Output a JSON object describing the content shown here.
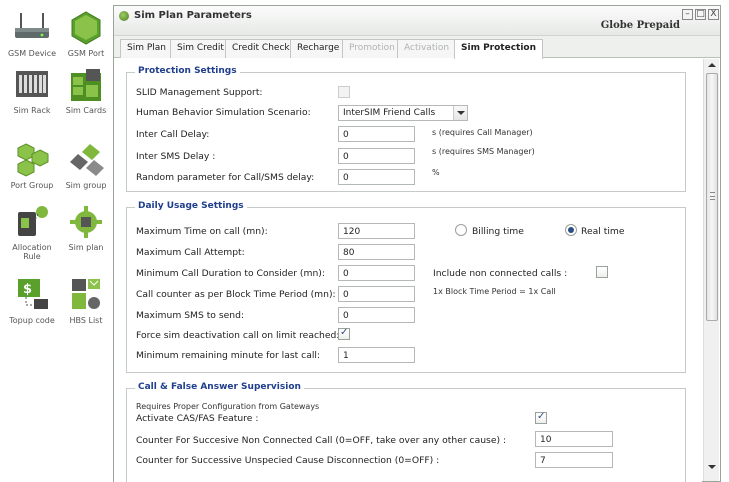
{
  "launcher": {
    "items": [
      {
        "label": "GSM Device",
        "icon": "gsm-device-icon"
      },
      {
        "label": "GSM Port",
        "icon": "gsm-port-icon"
      },
      {
        "label": "Sim Rack",
        "icon": "sim-rack-icon"
      },
      {
        "label": "Sim Cards",
        "icon": "sim-cards-icon"
      },
      {
        "label": "Port Group",
        "icon": "port-group-icon"
      },
      {
        "label": "Sim group",
        "icon": "sim-group-icon"
      },
      {
        "label": "Allocation Rule",
        "icon": "allocation-rule-icon"
      },
      {
        "label": "Sim plan",
        "icon": "sim-plan-icon"
      },
      {
        "label": "Topup code",
        "icon": "topup-code-icon"
      },
      {
        "label": "HBS List",
        "icon": "hbs-list-icon"
      }
    ]
  },
  "window": {
    "title": "Sim Plan Parameters",
    "subtitle": "Globe Prepaid",
    "buttons": {
      "minimize": "–",
      "maximize": "□",
      "close": "X"
    }
  },
  "tabs": [
    {
      "label": "Sim Plan",
      "state": "normal"
    },
    {
      "label": "Sim Credit",
      "state": "normal"
    },
    {
      "label": "Credit Check",
      "state": "normal"
    },
    {
      "label": "Recharge",
      "state": "normal"
    },
    {
      "label": "Promotion",
      "state": "disabled"
    },
    {
      "label": "Activation",
      "state": "disabled"
    },
    {
      "label": "Sim Protection",
      "state": "active"
    }
  ],
  "protection": {
    "legend": "Protection Settings",
    "slid_label": "SLID Management Support:",
    "hbs_label": "Human Behavior Simulation Scenario:",
    "hbs_value": "InterSIM Friend Calls",
    "call_delay_label": "Inter Call Delay:",
    "call_delay_value": "0",
    "call_delay_note": "s (requires Call Manager)",
    "sms_delay_label": "Inter SMS Delay :",
    "sms_delay_value": "0",
    "sms_delay_note": "s (requires SMS Manager)",
    "random_label": "Random parameter for Call/SMS delay:",
    "random_value": "0",
    "random_note": "%"
  },
  "daily": {
    "legend": "Daily Usage Settings",
    "max_time_label": "Maximum Time on call (mn):",
    "max_time_value": "120",
    "billing_label": "Billing time",
    "real_label": "Real time",
    "max_attempt_label": "Maximum Call Attempt:",
    "max_attempt_value": "80",
    "min_duration_label": "Minimum Call Duration to Consider (mn):",
    "min_duration_value": "0",
    "include_label": "Include non connected calls :",
    "counter_label": "Call counter as per Block Time Period (mn):",
    "counter_value": "0",
    "counter_note": "1x Block Time Period = 1x Call",
    "max_sms_label": "Maximum SMS to send:",
    "max_sms_value": "0",
    "force_label": "Force sim deactivation call on limit reached:",
    "min_remaining_label": "Minimum remaining minute for last call:",
    "min_remaining_value": "1"
  },
  "cfas": {
    "legend": "Call & False Answer Supervision",
    "requires_note": "Requires Proper Configuration from Gateways",
    "activate_label": "Activate CAS/FAS Feature :",
    "non_connected_label": "Counter For Succesive Non Connected Call (0=OFF, take over any other cause) :",
    "non_connected_value": "10",
    "unspecified_label": "Counter for Successive Unspecied Cause Disconnection (0=OFF) :",
    "unspecified_value": "7"
  }
}
